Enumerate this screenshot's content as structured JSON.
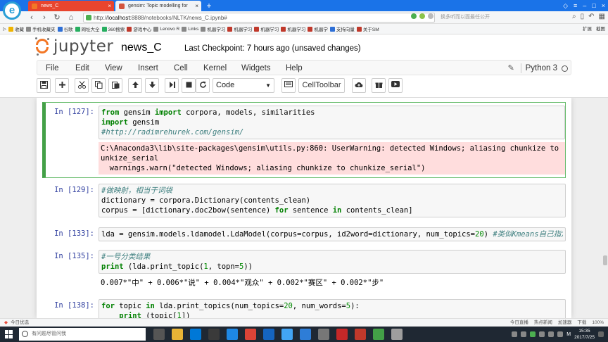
{
  "browser": {
    "tabs": [
      {
        "title": "news_C",
        "active": true
      },
      {
        "title": "gensim: Topic modelling for",
        "active": false
      }
    ],
    "url_prefix": "http://",
    "url_host": "localhost",
    "url_path": ":8888/notebooks/NLTK/news_C.ipynb#",
    "search_hint": "换多听而以面最任公开",
    "bookmarks": [
      "收藏",
      "手机收藏夹",
      "谷歌",
      "网址大全",
      "360搜索",
      "游戏中心",
      "Lenovo R",
      "Links",
      "机器学习",
      "机器学习",
      "机器学习",
      "机器学习",
      "机器学",
      "支持向量",
      "关于SM"
    ],
    "bookmark_right": [
      "扩展",
      "截图"
    ]
  },
  "jupyter": {
    "wordmark": "jupyter",
    "notebook_name": "news_C",
    "checkpoint": "Last Checkpoint: 7 hours ago (unsaved changes)",
    "menu": [
      "File",
      "Edit",
      "View",
      "Insert",
      "Cell",
      "Kernel",
      "Widgets",
      "Help"
    ],
    "kernel": "Python 3",
    "cell_type": "Code",
    "celltoolbar_label": "CellToolbar"
  },
  "cells": {
    "c127": {
      "prompt": "In [127]:",
      "input": {
        "l1": {
          "kw1": "from",
          "a": " gensim ",
          "kw2": "import",
          "b": " corpora, models, similarities"
        },
        "l2": {
          "kw1": "import",
          "a": " gensim"
        },
        "l3": "#http://radimrehurek.com/gensim/"
      },
      "output": [
        "C:\\Anaconda3\\lib\\site-packages\\gensim\\utils.py:860: UserWarning: detected Windows; aliasing chunkize to ch",
        "unkize_serial",
        "  warnings.warn(\"detected Windows; aliasing chunkize to chunkize_serial\")"
      ]
    },
    "c129": {
      "prompt": "In [129]:",
      "input": {
        "l1": "#做映射，相当于词袋",
        "l2": "dictionary = corpora.Dictionary(contents_clean)",
        "l3": {
          "a": "corpus = [dictionary.doc2bow(sentence) ",
          "kw1": "for",
          "b": " sentence ",
          "kw2": "in",
          "c": " contents_clean]"
        }
      }
    },
    "c133": {
      "prompt": "In [133]:",
      "input": {
        "a": "lda = gensim.models.ldamodel.LdaModel(corpus=corpus, id2word=dictionary, num_topics=",
        "n": "20",
        "b": ") ",
        "c": "#类似Kmeans自己指定K值"
      }
    },
    "c135": {
      "prompt": "In [135]:",
      "input": {
        "l1": "#一号分类结果",
        "l2": {
          "kw1": "print",
          "a": " (lda.print_topic(",
          "n1": "1",
          "b": ", topn=",
          "n2": "5",
          "c": "))"
        }
      },
      "output": "0.007*\"中\" + 0.006*\"说\" + 0.004*\"观众\" + 0.002*\"赛区\" + 0.002*\"步\""
    },
    "c138": {
      "prompt": "In [138]:",
      "input": {
        "l1": {
          "kw1": "for",
          "a": " topic ",
          "kw2": "in",
          "b": " lda.print_topics(num_topics=",
          "n1": "20",
          "c": ", num_words=",
          "n2": "5",
          "d": "):"
        },
        "l2": {
          "indent": "    ",
          "kw1": "print",
          "a": " (topic[",
          "n1": "1",
          "b": "])"
        }
      }
    }
  },
  "statusbar": {
    "left": "今日优选",
    "right": [
      "今日直播",
      "热点新闻",
      "加速器",
      "下载",
      "100%"
    ]
  },
  "taskbar": {
    "search_placeholder": "有问题尽管问我",
    "time": "15:35",
    "date": "2017/7/25",
    "ime": "M"
  },
  "colors": {
    "jupyter_orange": "#f37726",
    "selected_green": "#43a047",
    "stderr_bg": "#ffdddd",
    "prompt_blue": "#303f9f",
    "keyword_green": "#008000",
    "comment_teal": "#408080"
  }
}
